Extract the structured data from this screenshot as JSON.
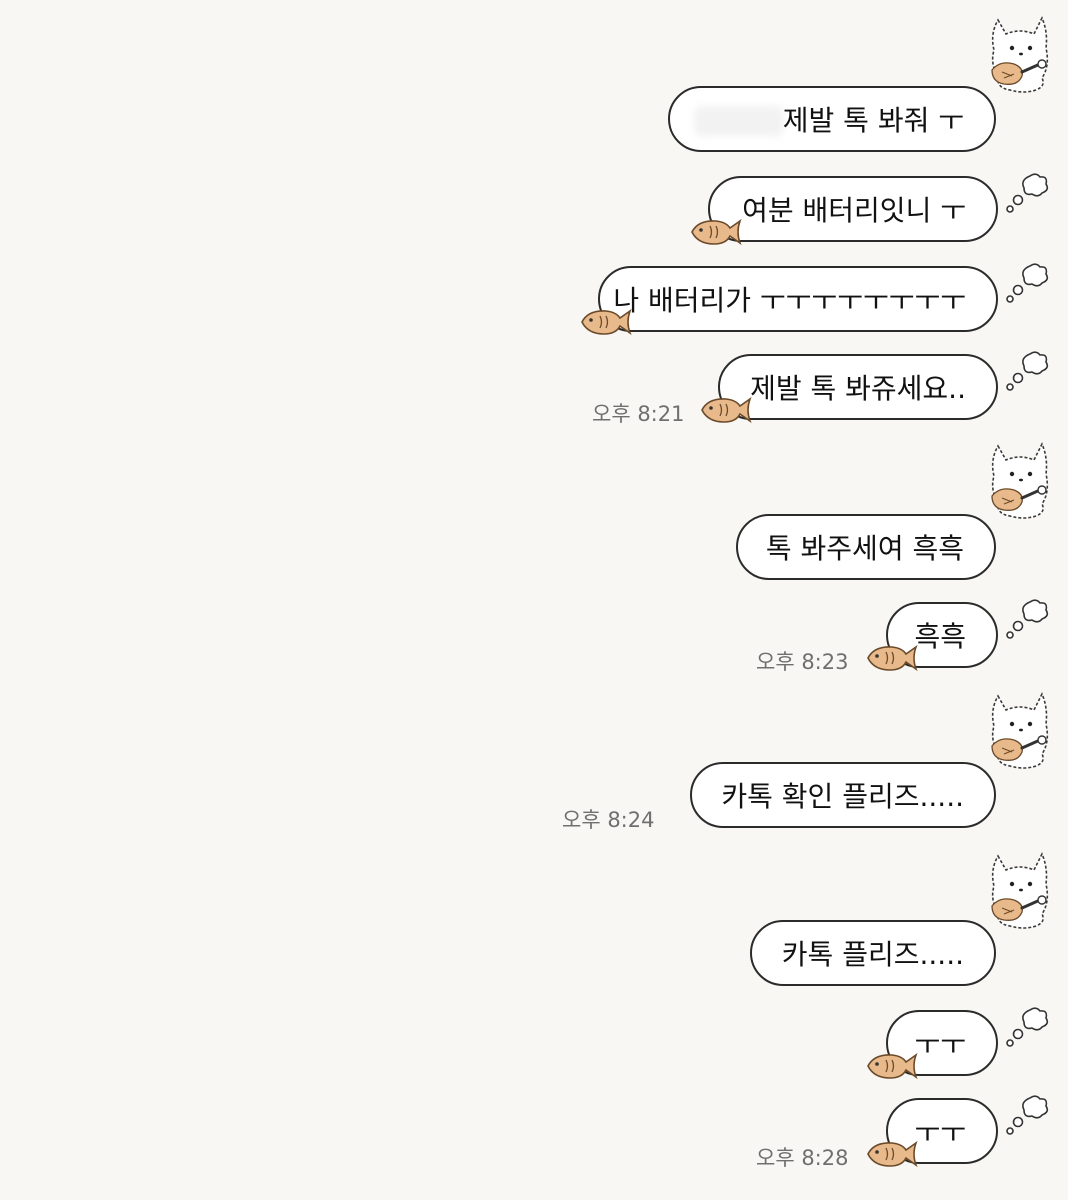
{
  "messages": [
    {
      "text": "제발 톡 봐줘 ㅜ"
    },
    {
      "text": "여분 배터리잇니 ㅜ"
    },
    {
      "text": "나 배터리가 ㅜㅜㅜㅜㅜㅜㅜㅜ"
    },
    {
      "text": "제발 톡 봐쥬세요..",
      "time": "오후 8:21"
    },
    {
      "text": "톡 봐주세여 흑흑"
    },
    {
      "text": "흑흑",
      "time": "오후 8:23"
    },
    {
      "text": "카톡 확인 플리즈.....",
      "time": "오후 8:24"
    },
    {
      "text": "카톡 플리즈....."
    },
    {
      "text": "ㅜㅜ"
    },
    {
      "text": "ㅜㅜ",
      "time": "오후 8:28"
    }
  ],
  "icons": {
    "cat": "cat-holding-fish-icon",
    "fish": "fish-bread-icon",
    "thought": "thought-bubble-icon"
  },
  "colors": {
    "background": "#f8f7f3",
    "bubble_fill": "#ffffff",
    "bubble_border": "#2b2b2b",
    "timestamp": "#6f6f6f",
    "fish": "#e8b98a"
  }
}
